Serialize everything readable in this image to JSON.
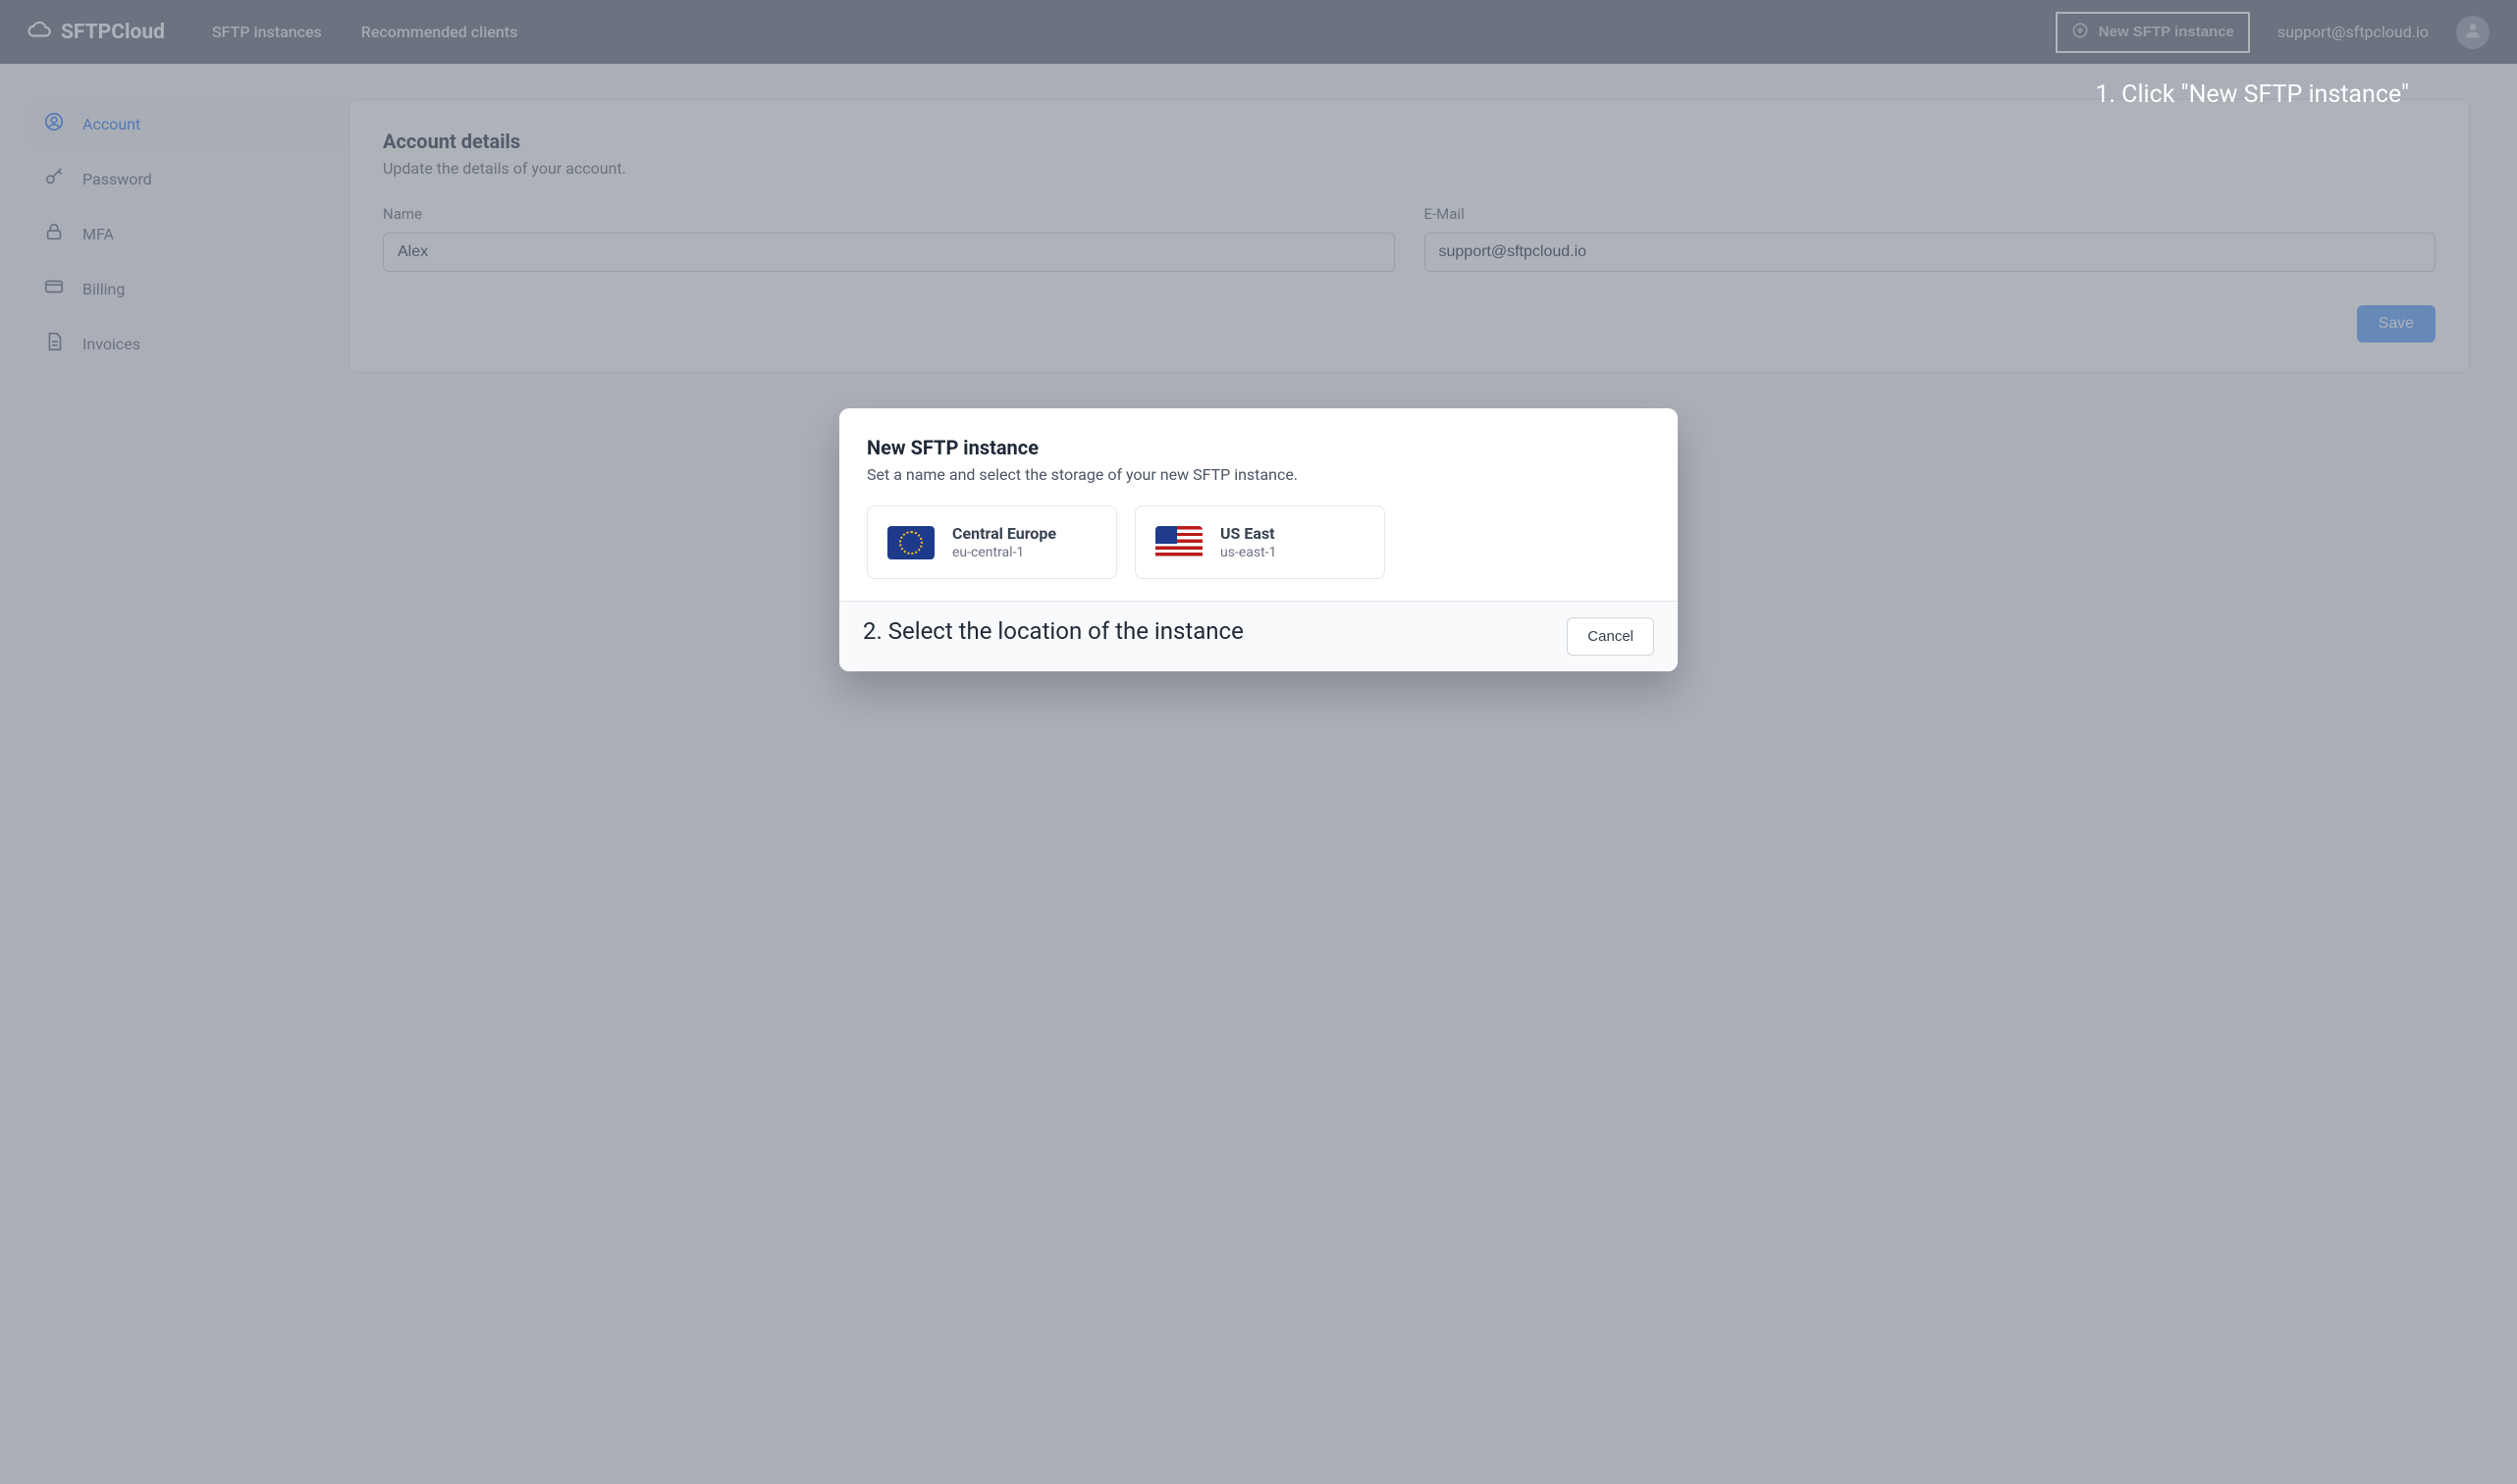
{
  "brand": {
    "name": "SFTPCloud"
  },
  "nav": {
    "links": [
      "SFTP instances",
      "Recommended clients"
    ],
    "new_instance_label": "New SFTP instance",
    "support_email": "support@sftpcloud.io"
  },
  "annotations": {
    "step1": "1. Click \"New SFTP instance\"",
    "step2": "2. Select the location of the instance"
  },
  "sidebar": {
    "items": [
      {
        "label": "Account",
        "icon": "user-circle-icon",
        "active": true
      },
      {
        "label": "Password",
        "icon": "key-icon",
        "active": false
      },
      {
        "label": "MFA",
        "icon": "lock-icon",
        "active": false
      },
      {
        "label": "Billing",
        "icon": "card-icon",
        "active": false
      },
      {
        "label": "Invoices",
        "icon": "document-icon",
        "active": false
      }
    ]
  },
  "account_card": {
    "title": "Account details",
    "subtitle": "Update the details of your account.",
    "name_label": "Name",
    "name_value": "Alex",
    "email_label": "E-Mail",
    "email_value": "support@sftpcloud.io",
    "save_label": "Save"
  },
  "modal": {
    "title": "New SFTP instance",
    "subtitle": "Set a name and select the storage of your new SFTP instance.",
    "regions": [
      {
        "name": "Central Europe",
        "code": "eu-central-1",
        "flag": "eu"
      },
      {
        "name": "US East",
        "code": "us-east-1",
        "flag": "us"
      }
    ],
    "cancel_label": "Cancel"
  }
}
